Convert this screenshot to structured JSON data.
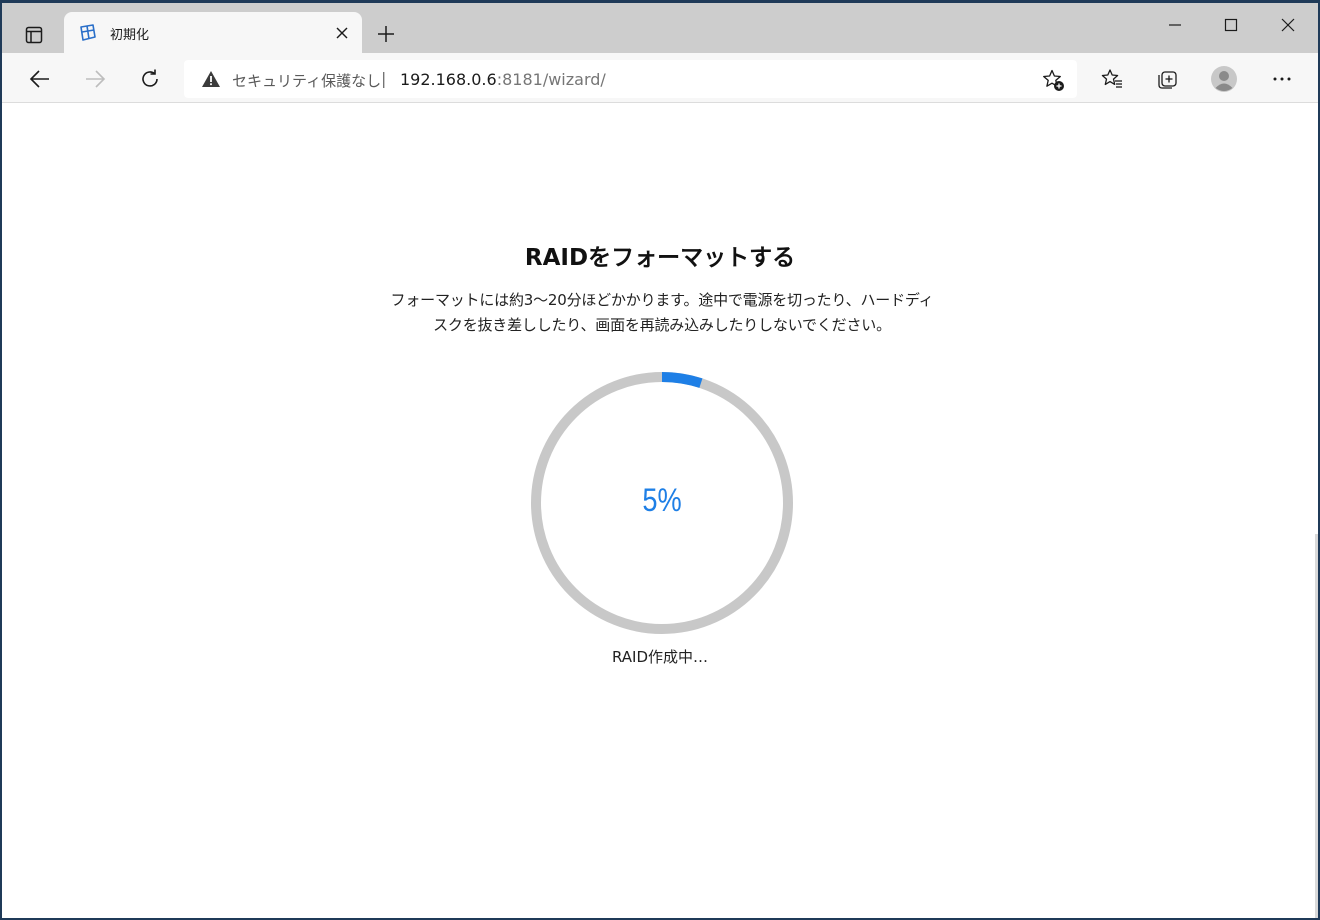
{
  "browser": {
    "tab": {
      "title": "初期化"
    },
    "address": {
      "security_label": "セキュリティ保護なし",
      "separator": "|",
      "url_host": "192.168.0.6",
      "url_rest": ":8181/wizard/"
    }
  },
  "page": {
    "heading": "RAIDをフォーマットする",
    "description_line1": "フォーマットには約3～20分ほどかかります。途中で電源を切ったり、ハードディ",
    "description_line2": "スクを抜き差ししたり、画面を再読み込みしたりしないでください。",
    "progress": {
      "value": 5,
      "label": "5%",
      "status": "RAID作成中…"
    }
  },
  "colors": {
    "accent": "#1e7fe6",
    "track": "#c8c8c8",
    "tabstrip": "#cdcdcd",
    "toolbar": "#f7f7f7"
  },
  "icons": {
    "tab_actions": "tab-actions-icon",
    "favicon": "wizard-favicon-icon",
    "tab_close": "close-icon",
    "new_tab": "plus-icon",
    "minimize": "minimize-icon",
    "maximize": "maximize-icon",
    "close_window": "close-icon",
    "back": "back-arrow-icon",
    "forward": "forward-arrow-icon",
    "refresh": "refresh-icon",
    "warning": "warning-icon",
    "add_favorite": "star-plus-icon",
    "favorites": "favorites-icon",
    "collections": "collections-icon",
    "profile": "profile-avatar-icon",
    "menu": "more-icon"
  }
}
